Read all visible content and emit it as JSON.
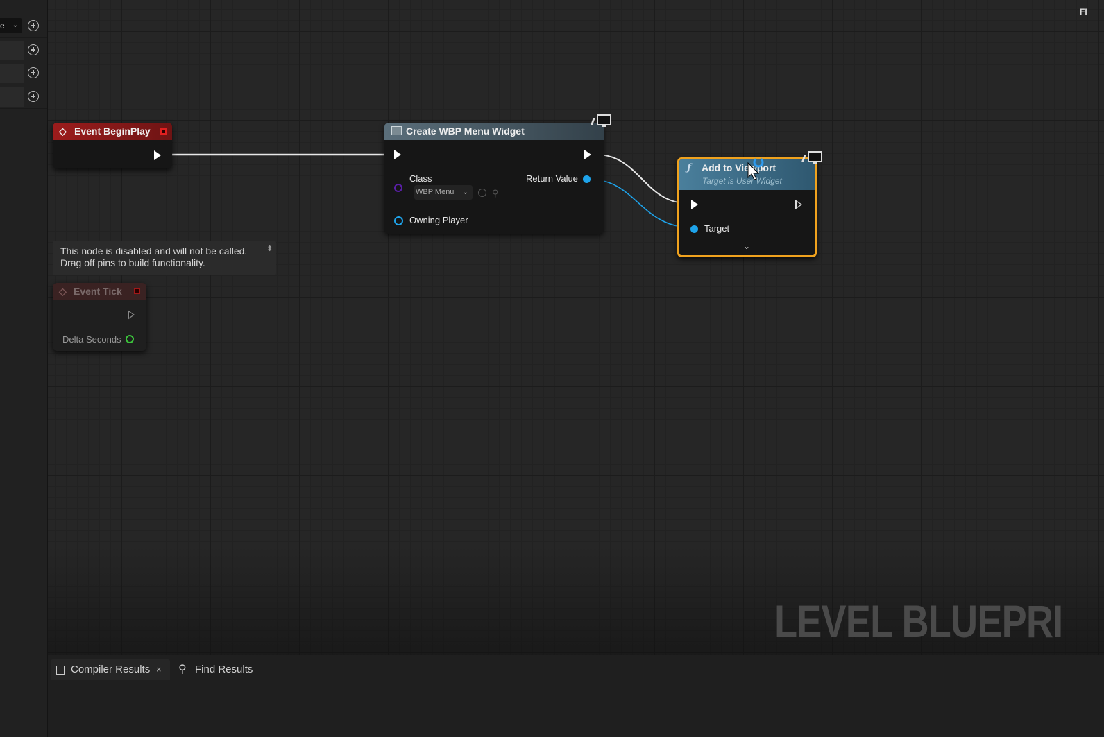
{
  "side_panel": {
    "dropdown_text": "e",
    "add_buttons": [
      "add",
      "add",
      "add",
      "add"
    ]
  },
  "graph": {
    "watermark": "LEVEL BLUEPRI",
    "corner_text": "FI"
  },
  "nodes": {
    "begin_play": {
      "title": "Event BeginPlay"
    },
    "create_widget": {
      "title": "Create WBP Menu Widget",
      "class_label": "Class",
      "class_value": "WBP Menu",
      "return_label": "Return Value",
      "owning_label": "Owning Player"
    },
    "add_to_viewport": {
      "title": "Add to Viewport",
      "subtitle": "Target is User Widget",
      "target_label": "Target"
    },
    "tick": {
      "title": "Event Tick",
      "delta_label": "Delta Seconds"
    }
  },
  "tooltip": {
    "line1": "This node is disabled and will not be called.",
    "line2": "Drag off pins to build functionality."
  },
  "bottom_tabs": {
    "compiler": "Compiler Results",
    "find": "Find Results",
    "close": "×"
  },
  "colors": {
    "event_red": "#8e1a1a",
    "function_blue": "#3d6f8c",
    "object_pin": "#1ea3ea",
    "class_pin": "#5a1fa8",
    "float_pin": "#3cc63c",
    "selection": "#f0a21e"
  }
}
